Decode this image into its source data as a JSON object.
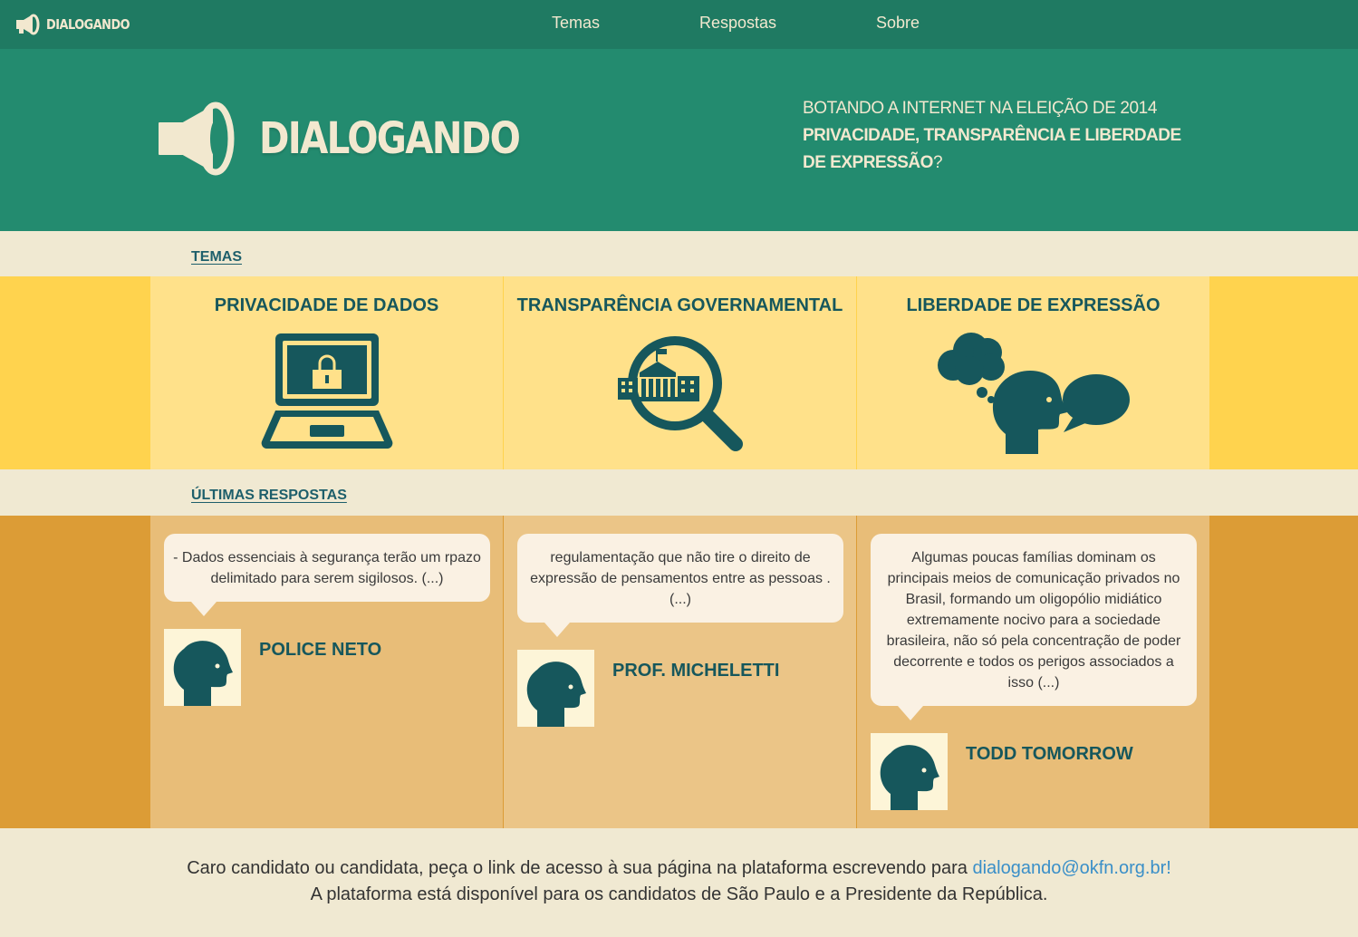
{
  "nav": {
    "brand": "DIALOGANDO",
    "links": [
      "Temas",
      "Respostas",
      "Sobre"
    ]
  },
  "hero": {
    "title": "DIALOGANDO",
    "tagline_1": "BOTANDO A INTERNET NA ELEIÇÃO DE 2014",
    "tagline_2": "PRIVACIDADE, TRANSPARÊNCIA E LIBERDADE DE EXPRESSÃO",
    "tagline_end": "?"
  },
  "temas": {
    "label": "TEMAS",
    "items": [
      {
        "title": "PRIVACIDADE DE DADOS",
        "icon": "laptop-lock-icon"
      },
      {
        "title": "TRANSPARÊNCIA GOVERNAMENTAL",
        "icon": "magnifier-government-icon"
      },
      {
        "title": "LIBERDADE DE EXPRESSÃO",
        "icon": "head-thought-speech-icon"
      }
    ]
  },
  "respostas": {
    "label": "ÚLTIMAS RESPOSTAS",
    "items": [
      {
        "quote": "- Dados essenciais à segurança terão um rpazo delimitado para serem sigilosos. (...)",
        "author": "POLICE NETO"
      },
      {
        "quote": "regulamentação que não tire o direito de expressão de pensamentos entre as pessoas . (...)",
        "author": "PROF. MICHELETTI"
      },
      {
        "quote": "Algumas poucas famílias dominam os principais meios de comunicação privados no Brasil, formando um oligopólio midiático extremamente nocivo para a sociedade brasileira, não só pela concentração de poder decorrente e todos os perigos associados a isso (...)",
        "author": "TODD TOMORROW"
      }
    ]
  },
  "footer": {
    "line1": "Caro candidato ou candidata, peça o link de acesso à sua página na plataforma escrevendo para ",
    "email": "dialogando@okfn.org.br!",
    "line2": "A plataforma está disponível para os candidatos de São Paulo e a Presidente da República."
  },
  "colors": {
    "nav": "#1f7a62",
    "hero": "#238b6f",
    "cream": "#f0e9d2",
    "yellow": "#ffd34e",
    "yellow_card": "#ffe18a",
    "orange": "#dc9c36",
    "icon": "#16575c"
  }
}
